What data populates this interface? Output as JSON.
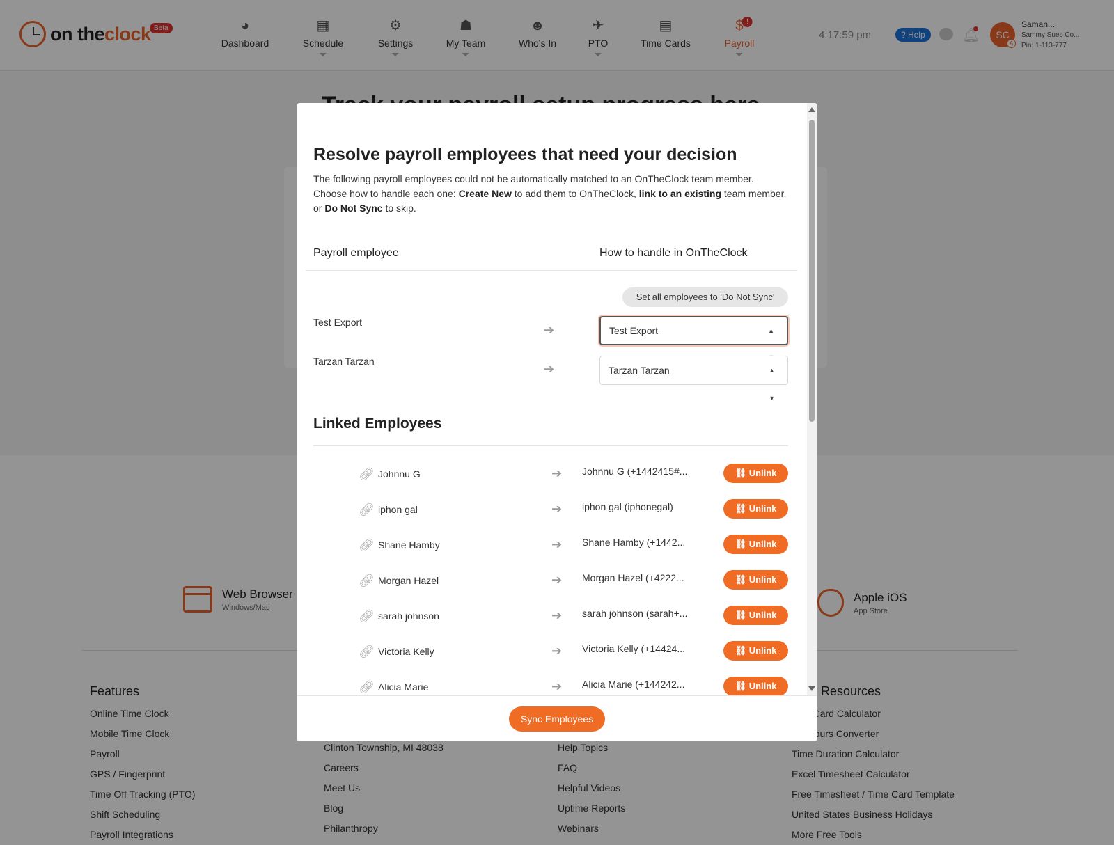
{
  "brand": {
    "logo_on": "on the",
    "logo_clock": "clock",
    "beta": "Beta"
  },
  "nav": [
    {
      "label": "Dashboard",
      "icon": "dashboard-icon",
      "glyph": "◕",
      "caret": false
    },
    {
      "label": "Schedule",
      "icon": "calendar-icon",
      "glyph": "▦",
      "caret": true
    },
    {
      "label": "Settings",
      "icon": "gears-icon",
      "glyph": "⚙",
      "caret": true
    },
    {
      "label": "My Team",
      "icon": "team-icon",
      "glyph": "☗",
      "caret": true
    },
    {
      "label": "Who's In",
      "icon": "whos-in-icon",
      "glyph": "☻",
      "caret": false
    },
    {
      "label": "PTO",
      "icon": "plane-icon",
      "glyph": "✈",
      "caret": true
    },
    {
      "label": "Time Cards",
      "icon": "timecards-icon",
      "glyph": "▤",
      "caret": false
    },
    {
      "label": "Payroll",
      "icon": "payroll-dollar-icon",
      "glyph": "$",
      "caret": true,
      "badge": "!"
    }
  ],
  "header": {
    "time": "4:17:59 pm",
    "help": "? Help",
    "avatar_initials": "SC",
    "avatar_badge": "A",
    "user_name": "Saman...",
    "company": "Sammy Sues Co...",
    "pin": "Pin: 1-113-777"
  },
  "background": {
    "heading": "Track your payroll setup progress here",
    "platforms": [
      {
        "title": "Web Browser",
        "sub": "Windows/Mac"
      },
      {
        "title": "Apple iOS",
        "sub": "App Store"
      }
    ],
    "footer": {
      "features": {
        "title": "Features",
        "links": [
          "Online Time Clock",
          "Mobile Time Clock",
          "Payroll",
          "GPS / Fingerprint",
          "Time Off Tracking (PTO)",
          "Shift Scheduling",
          "Payroll Integrations"
        ]
      },
      "company": {
        "links": [
          "Clinton Township, MI 48038",
          "Careers",
          "Meet Us",
          "Blog",
          "Philanthropy"
        ]
      },
      "support": {
        "links": [
          "Help Topics",
          "FAQ",
          "Helpful Videos",
          "Uptime Reports",
          "Webinars"
        ]
      },
      "resources": {
        "title": "Resources",
        "links": [
          "TimeCard Calculator",
          "nal Hours Converter",
          "Time Duration Calculator",
          "Excel Timesheet Calculator",
          "Free Timesheet / Time Card Template",
          "United States Business Holidays",
          "More Free Tools"
        ]
      }
    }
  },
  "modal": {
    "title": "Resolve payroll employees that need your decision",
    "desc": {
      "p1": "The following payroll employees could not be automatically matched to an OnTheClock team member. Choose how to handle each one: ",
      "b1": "Create New",
      "p2": " to add them to OnTheClock, ",
      "b2": "link to an existing",
      "p3": " team member, or ",
      "b3": "Do Not Sync",
      "p4": " to skip."
    },
    "col_left": "Payroll employee",
    "col_right": "How to handle in OnTheClock",
    "set_all_button": "Set all employees to 'Do Not Sync'",
    "unresolved": [
      {
        "name": "Test Export",
        "selected": "Test Export"
      },
      {
        "name": "Tarzan Tarzan",
        "selected": "Tarzan Tarzan"
      }
    ],
    "linked_title": "Linked Employees",
    "linked": [
      {
        "name": "Johnnu G",
        "target": "Johnnu G (+1442415#..."
      },
      {
        "name": "iphon gal",
        "target": "iphon gal (iphonegal)"
      },
      {
        "name": "Shane Hamby",
        "target": "Shane Hamby (+1442..."
      },
      {
        "name": "Morgan Hazel",
        "target": "Morgan Hazel (+4222..."
      },
      {
        "name": "sarah johnson",
        "target": "sarah johnson (sarah+..."
      },
      {
        "name": "Victoria Kelly",
        "target": "Victoria Kelly (+14424..."
      },
      {
        "name": "Alicia Marie",
        "target": "Alicia Marie (+144242..."
      }
    ],
    "unlink_label": "Unlink",
    "sync_button": "Sync Employees"
  }
}
